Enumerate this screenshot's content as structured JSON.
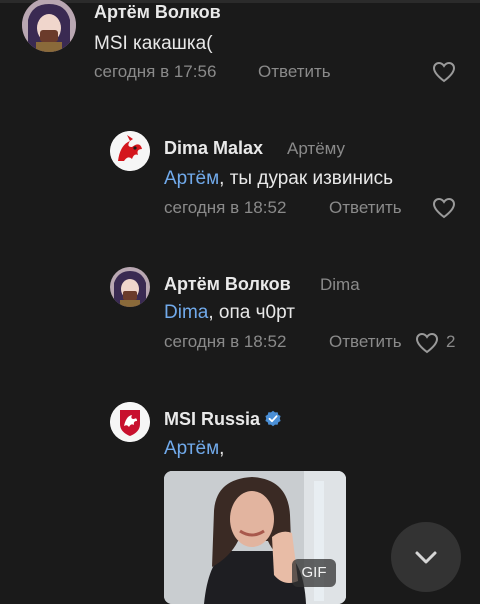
{
  "comments": [
    {
      "author": "Артём Волков",
      "text": "MSI какашка(",
      "time": "сегодня в 17:56",
      "reply_label": "Ответить"
    },
    {
      "author": "Dima Malax",
      "reply_to": "Артёму",
      "mention": "Артём",
      "text": ", ты дурак извинись",
      "time": "сегодня в 18:52",
      "reply_label": "Ответить"
    },
    {
      "author": "Артём Волков",
      "reply_to": "Dima",
      "mention": "Dima",
      "text": ", опа ч0рт",
      "time": "сегодня в 18:52",
      "reply_label": "Ответить",
      "likes": "2"
    },
    {
      "author": "MSI Russia",
      "mention": "Артём",
      "text": ",",
      "attachment_badge": "GIF"
    }
  ],
  "icons": {
    "heart": "heart-outline-icon",
    "verified": "verified-badge-icon",
    "scroll_down": "chevron-down-icon"
  },
  "colors": {
    "background": "#1a1a1a",
    "mention": "#71aaeb",
    "secondary_text": "#8a8a8a",
    "verified": "#4a8fd6",
    "msi_red": "#c8102e"
  }
}
